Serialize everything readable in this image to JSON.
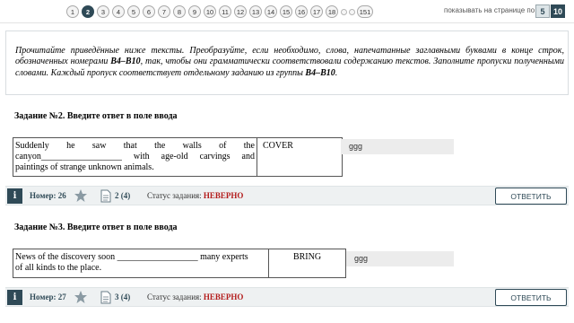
{
  "pagination": {
    "pages": [
      "1",
      "2",
      "3",
      "4",
      "5",
      "6",
      "7",
      "8",
      "9",
      "10",
      "11",
      "12",
      "13",
      "14",
      "15",
      "16",
      "17",
      "18"
    ],
    "current": "2",
    "last_page": "151",
    "per_page_label": "показывать на странице по:",
    "per_page_options": [
      "5",
      "10"
    ],
    "per_page_selected": "10"
  },
  "instruction": {
    "text_part1": "Прочитайте приведённые ниже тексты. Преобразуйте, если необходимо, слова, напечатанные заглавными буквами в конце строк, обозначенных номерами ",
    "range1": "B4–B10",
    "text_part2": ", так, чтобы они грамматически соответствовали содержанию текстов. Заполните пропуски полученными словами. Каждый пропуск соответствует отдельному заданию из группы ",
    "range2": "B4–B10",
    "text_part3": "."
  },
  "tasks": [
    {
      "title": "Задание №2. Введите ответ в поле ввода",
      "sentence_line1": "Suddenly he saw that the walls of the",
      "sentence_line2": "canyon__________________ with age-old carvings and",
      "sentence_line3": "paintings of strange unknown animals.",
      "keyword": "COVER",
      "answer": "ggg",
      "number_label": "Номер: 26",
      "doc_count": "2 (4)",
      "status_label": "Статус задания:",
      "status_value": "НЕВЕРНО",
      "answer_button": "ОТВЕТИТЬ"
    },
    {
      "title": "Задание №3. Введите ответ в поле ввода",
      "sentence_line1": "News of the discovery soon __________________ many experts",
      "sentence_line2": "of all kinds to the place.",
      "keyword": "BRING",
      "answer": "ggg",
      "number_label": "Номер: 27",
      "doc_count": "3 (4)",
      "status_label": "Статус задания:",
      "status_value": "НЕВЕРНО",
      "answer_button": "ОТВЕТИТЬ"
    }
  ],
  "colors": {
    "accent": "#2f4a57",
    "status_wrong": "#b31b1b",
    "answer_bg": "#ececec"
  },
  "icons": [
    "info-icon",
    "star-icon",
    "document-icon"
  ]
}
